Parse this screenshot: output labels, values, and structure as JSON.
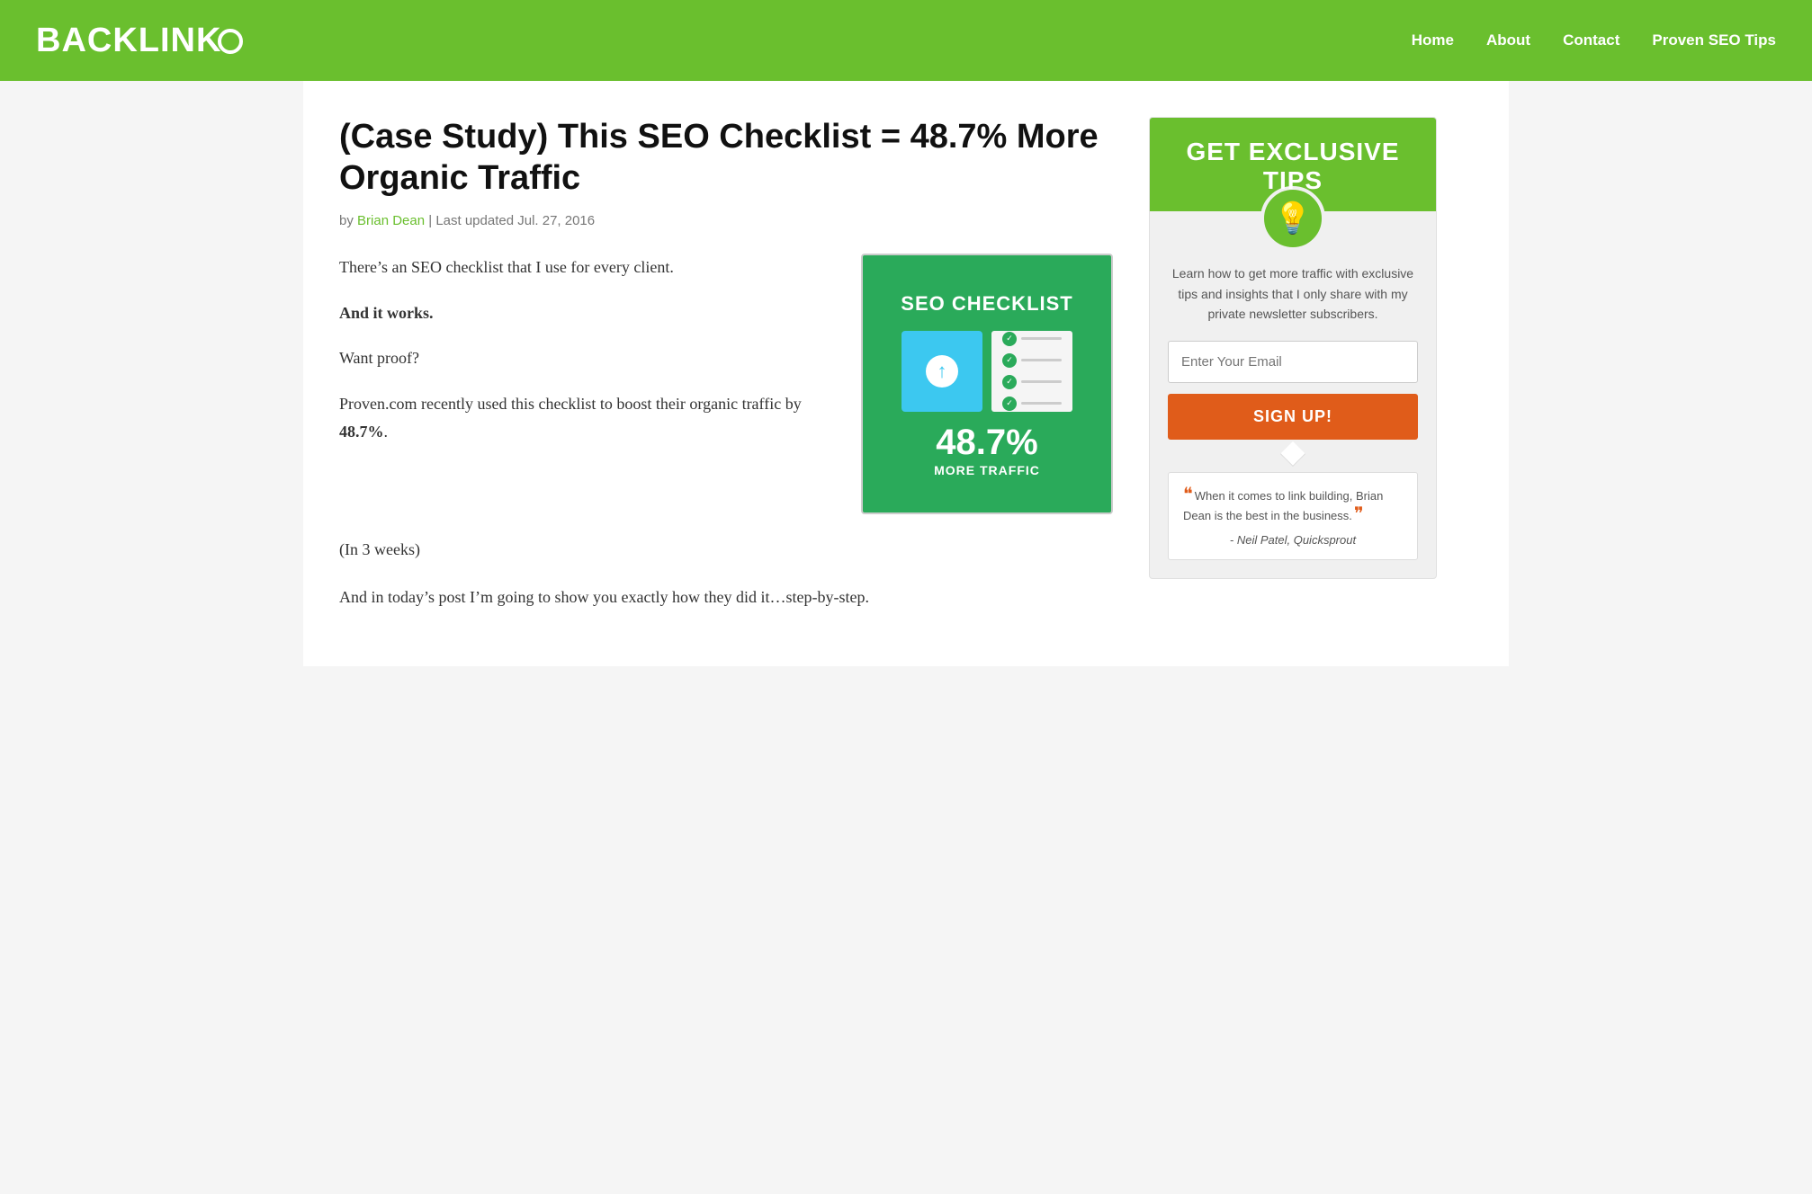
{
  "header": {
    "logo_text": "BACKLINK",
    "logo_o": "O",
    "nav": {
      "home": "Home",
      "about": "About",
      "contact": "Contact",
      "proven_seo": "Proven SEO Tips"
    }
  },
  "article": {
    "title": "(Case Study) This SEO Checklist = 48.7% More Organic Traffic",
    "meta_by": "by",
    "meta_author": "Brian Dean",
    "meta_separator": "|",
    "meta_updated": "Last updated Jul. 27, 2016",
    "para1": "There’s an SEO checklist that I use for every client.",
    "bold1": "And it works.",
    "para2": "Want proof?",
    "para3_prefix": "Proven.com recently used this checklist to boost their organic traffic by",
    "para3_bold": "48.7%",
    "para3_suffix": ".",
    "para4": "(In 3 weeks)",
    "para5": "And in today’s post I’m going to show you exactly how they did it…step-by-step.",
    "image": {
      "title": "SEO CHECKLIST",
      "stat": "48.7%",
      "stat_label": "MORE TRAFFIC"
    }
  },
  "sidebar": {
    "widget_title": "GET EXCLUSIVE TIPS",
    "bulb_icon": "💡",
    "description": "Learn how to get more traffic with exclusive tips and insights that I only share with my private newsletter subscribers.",
    "email_placeholder": "Enter Your Email",
    "signup_label": "SIGN UP!",
    "testimonial_text": "When it comes to link building, Brian Dean is the best in the business.",
    "testimonial_author": "- Neil Patel, Quicksprout"
  }
}
